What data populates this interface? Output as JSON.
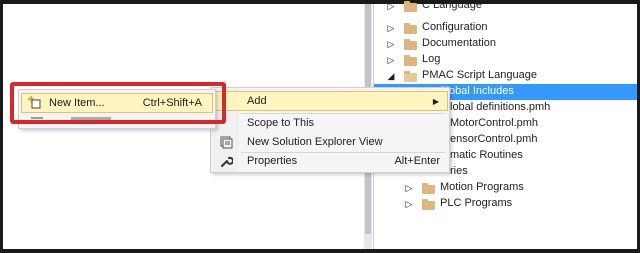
{
  "tree": {
    "items": [
      {
        "label": "C Language",
        "expander": "▷",
        "open": false,
        "indent": 0,
        "selected": false
      },
      {
        "label": "Configuration",
        "expander": "▷",
        "open": false,
        "indent": 0,
        "selected": false
      },
      {
        "label": "Documentation",
        "expander": "▷",
        "open": false,
        "indent": 0,
        "selected": false
      },
      {
        "label": "Log",
        "expander": "▷",
        "open": false,
        "indent": 0,
        "selected": false
      },
      {
        "label": "PMAC Script Language",
        "expander": "◢",
        "open": true,
        "indent": 0,
        "selected": false
      },
      {
        "label": "Global Includes",
        "expander": "◢",
        "open": true,
        "indent": 1,
        "selected": true
      },
      {
        "label": "lobal definitions.pmh",
        "expander": "",
        "open": false,
        "indent": 2,
        "selected": false
      },
      {
        "label": "MotorControl.pmh",
        "expander": "",
        "open": false,
        "indent": 2,
        "selected": false
      },
      {
        "label": "ensorControl.pmh",
        "expander": "",
        "open": false,
        "indent": 2,
        "selected": false
      },
      {
        "label": "matic Routines",
        "expander": "",
        "open": false,
        "indent": 1,
        "selected": false
      },
      {
        "label": "ries",
        "expander": "",
        "open": false,
        "indent": 1,
        "selected": false
      },
      {
        "label": "Motion Programs",
        "expander": "▷",
        "open": false,
        "indent": 1,
        "selected": false
      },
      {
        "label": "PLC Programs",
        "expander": "▷",
        "open": false,
        "indent": 1,
        "selected": false
      }
    ]
  },
  "context_menu": {
    "add": {
      "label": "Add",
      "arrow": "▶"
    },
    "scope": {
      "label": "Scope to This"
    },
    "new_view": {
      "label": "New Solution Explorer View"
    },
    "properties": {
      "label": "Properties",
      "shortcut": "Alt+Enter"
    }
  },
  "submenu": {
    "new_item": {
      "label": "New Item...",
      "shortcut": "Ctrl+Shift+A"
    }
  },
  "colors": {
    "selection": "#3399ff",
    "menu_highlight": "#fdf4bf",
    "callout_border": "#d62929",
    "folder": "#dcb67a"
  }
}
